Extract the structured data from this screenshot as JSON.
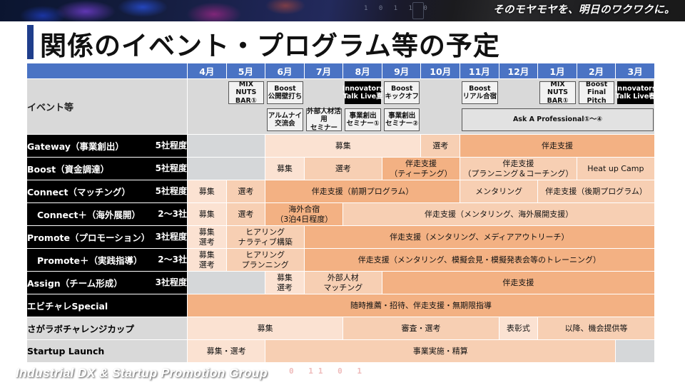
{
  "banner": {
    "tagline": "そのモヤモヤを、明日のワクワクに。",
    "binary": "1 0 1 1 0"
  },
  "title": "関係のイベント・プログラム等の予定",
  "footer": {
    "title": "Industrial DX & Startup Promotion Group",
    "binary": "0 11 0 1"
  },
  "colors": {
    "header_blue": "#4a73c4",
    "title_accent": "#1f3e8c",
    "shade_1": "#fbe2d2",
    "shade_2": "#f7cfb3",
    "shade_3": "#f3b183",
    "gray": "#d5d7d9"
  },
  "table": {
    "months": [
      "4月",
      "5月",
      "6月",
      "7月",
      "8月",
      "9月",
      "10月",
      "11月",
      "12月",
      "1月",
      "2月",
      "3月"
    ],
    "events_row": {
      "label": "イベント等",
      "items": [
        {
          "name": "MIX NUTS\nBAR①",
          "start": 1,
          "span": 1,
          "line": 0,
          "style": "box"
        },
        {
          "name": "Boost\n公開壁打ち",
          "start": 2,
          "span": 1,
          "line": 0,
          "style": "box"
        },
        {
          "name": "Innovators\nTalk Live夏",
          "start": 4,
          "span": 1,
          "line": 0,
          "style": "dark"
        },
        {
          "name": "Boost\nキックオフ",
          "start": 5,
          "span": 1,
          "line": 0,
          "style": "box"
        },
        {
          "name": "Boost\nリアル合宿",
          "start": 7,
          "span": 1,
          "line": 0,
          "style": "box"
        },
        {
          "name": "MIX NUTS\nBAR①",
          "start": 9,
          "span": 1,
          "line": 0,
          "style": "box"
        },
        {
          "name": "Boost\nFinal Pitch",
          "start": 10,
          "span": 1,
          "line": 0,
          "style": "box"
        },
        {
          "name": "Innovators\nTalk Live春",
          "start": 11,
          "span": 1,
          "line": 0,
          "style": "dark"
        },
        {
          "name": "アルムナイ\n交流会",
          "start": 2,
          "span": 1,
          "line": 1,
          "style": "box"
        },
        {
          "name": "外部人材活用\nセミナー",
          "start": 3,
          "span": 1,
          "line": 1,
          "style": "box"
        },
        {
          "name": "事業創出\nセミナー①",
          "start": 4,
          "span": 1,
          "line": 1,
          "style": "box"
        },
        {
          "name": "事業創出\nセミナー②",
          "start": 5,
          "span": 1,
          "line": 1,
          "style": "box"
        },
        {
          "name": "Ask A Professional①〜④",
          "start": 7,
          "span": 5,
          "line": 1,
          "style": "wide"
        }
      ]
    },
    "rows": [
      {
        "label": "Gateway（事業創出）",
        "count": "5社程度",
        "label_style": "black",
        "cells": [
          {
            "text": "",
            "span": 2,
            "shade": "gray"
          },
          {
            "text": "募集",
            "span": 4,
            "shade": "l1"
          },
          {
            "text": "選考",
            "span": 1,
            "shade": "l2"
          },
          {
            "text": "伴走支援",
            "span": 5,
            "shade": "l3"
          }
        ]
      },
      {
        "label": "Boost（資金調達）",
        "count": "5社程度",
        "label_style": "black",
        "cells": [
          {
            "text": "",
            "span": 2,
            "shade": "gray"
          },
          {
            "text": "募集",
            "span": 1,
            "shade": "l1"
          },
          {
            "text": "選考",
            "span": 2,
            "shade": "l2"
          },
          {
            "text": "伴走支援\n（ティーチング）",
            "span": 2,
            "shade": "l3"
          },
          {
            "text": "伴走支援\n（プランニング＆コーチング）",
            "span": 3,
            "shade": "l2"
          },
          {
            "text": "Heat up Camp",
            "span": 2,
            "shade": "l2"
          }
        ]
      },
      {
        "label": "Connect（マッチング）",
        "count": "5社程度",
        "label_style": "black",
        "cells": [
          {
            "text": "募集",
            "span": 1,
            "shade": "l1"
          },
          {
            "text": "選考",
            "span": 1,
            "shade": "l2"
          },
          {
            "text": "伴走支援（前期プログラム）",
            "span": 5,
            "shade": "l3"
          },
          {
            "text": "メンタリング",
            "span": 2,
            "shade": "l2"
          },
          {
            "text": "伴走支援（後期プログラム）",
            "span": 3,
            "shade": "l2"
          }
        ]
      },
      {
        "label": "Connect＋（海外展開）",
        "count": "2〜3社",
        "label_style": "black",
        "indent": true,
        "cells": [
          {
            "text": "募集",
            "span": 1,
            "shade": "l1"
          },
          {
            "text": "選考",
            "span": 1,
            "shade": "l2"
          },
          {
            "text": "海外合宿\n（3泊4日程度）",
            "span": 2,
            "shade": "l3"
          },
          {
            "text": "伴走支援（メンタリング、海外展開支援）",
            "span": 8,
            "shade": "l2"
          }
        ]
      },
      {
        "label": "Promote（プロモーション）",
        "count": "3社程度",
        "label_style": "black",
        "cells": [
          {
            "text": "募集\n選考",
            "span": 1,
            "shade": "l1"
          },
          {
            "text": "ヒアリング\nナラティブ構築",
            "span": 2,
            "shade": "l2"
          },
          {
            "text": "伴走支援（メンタリング、メディアアウトリーチ）",
            "span": 9,
            "shade": "l3"
          }
        ]
      },
      {
        "label": "Promote＋（実践指導）",
        "count": "2〜3社",
        "label_style": "black",
        "indent": true,
        "cells": [
          {
            "text": "募集\n選考",
            "span": 1,
            "shade": "l1"
          },
          {
            "text": "ヒアリング\nプランニング",
            "span": 2,
            "shade": "l2"
          },
          {
            "text": "伴走支援（メンタリング、模擬会見・模擬発表会等のトレーニング）",
            "span": 9,
            "shade": "l3"
          }
        ]
      },
      {
        "label": "Assign（チーム形成）",
        "count": "3社程度",
        "label_style": "black",
        "cells": [
          {
            "text": "",
            "span": 2,
            "shade": "gray"
          },
          {
            "text": "募集\n選考",
            "span": 1,
            "shade": "l1"
          },
          {
            "text": "外部人材\nマッチング",
            "span": 2,
            "shade": "l2"
          },
          {
            "text": "伴走支援",
            "span": 7,
            "shade": "l3"
          }
        ]
      },
      {
        "label": "エビチャレSpecial",
        "count": "",
        "label_style": "black",
        "cells": [
          {
            "text": "随時推薦・招待、伴走支援・無期限指導",
            "span": 12,
            "shade": "l3"
          }
        ]
      },
      {
        "label": "さがラボチャレンジカップ",
        "count": "",
        "label_style": "gray",
        "cells": [
          {
            "text": "募集",
            "span": 4,
            "shade": "l1"
          },
          {
            "text": "審査・選考",
            "span": 4,
            "shade": "l2"
          },
          {
            "text": "表彰式",
            "span": 1,
            "shade": "l1"
          },
          {
            "text": "以降、機会提供等",
            "span": 3,
            "shade": "l2"
          }
        ]
      },
      {
        "label": "Startup Launch",
        "count": "",
        "label_style": "gray",
        "cells": [
          {
            "text": "募集・選考",
            "span": 2,
            "shade": "l1"
          },
          {
            "text": "事業実施・精算",
            "span": 9,
            "shade": "l2"
          },
          {
            "text": "",
            "span": 1,
            "shade": "gray"
          }
        ]
      }
    ]
  }
}
